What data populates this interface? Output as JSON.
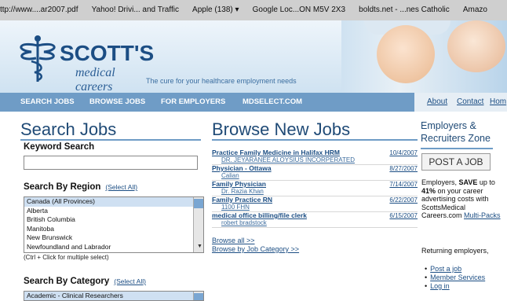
{
  "bookmarks": [
    "ttp://www....ar2007.pdf",
    "Yahoo! Drivi... and Traffic",
    "Apple (138) ▾",
    "Google Loc...ON M5V 2X3",
    "boldts.net - ...nes Catholic",
    "Amazo"
  ],
  "header": {
    "logo_name": "SCOTT'S",
    "logo_sub": "medical careers",
    "tagline": "The cure for your healthcare employment needs"
  },
  "nav": {
    "search_jobs": "SEARCH JOBS",
    "browse_jobs": "BROWSE JOBS",
    "for_employers": "FOR EMPLOYERS",
    "mdselect": "MDSELECT.COM"
  },
  "util": {
    "about": "About",
    "contact": "Contact",
    "home": "Hom"
  },
  "search": {
    "title": "Search Jobs",
    "keyword_label": "Keyword Search",
    "region_label": "Search By Region",
    "region_select_all": "(Select All)",
    "regions": [
      "Canada (All Provinces)",
      "Alberta",
      "British Columbia",
      "Manitoba",
      "New Brunswick",
      "Newfoundland and Labrador"
    ],
    "hint": "(Ctrl + Click for multiple select)",
    "category_label": "Search By Category",
    "category_select_all": "(Select All)",
    "categories": [
      "Academic - Clinical Researchers"
    ]
  },
  "browse": {
    "title": "Browse New Jobs",
    "jobs": [
      {
        "title": "Practice Family Medicine in Halifax HRM",
        "company": "DR. JEYARANEE ALOYSIUS INCORPERATED",
        "date": "10/4/2007"
      },
      {
        "title": "Physician - Ottawa",
        "company": "Calian",
        "date": "8/27/2007"
      },
      {
        "title": "Family Physician",
        "company": "Dr. Razia Khan",
        "date": "7/14/2007"
      },
      {
        "title": "Family Practice RN",
        "company": "1100 FHN",
        "date": "6/22/2007"
      },
      {
        "title": "medical office billing/file clerk",
        "company": "robert bradstock",
        "date": "6/15/2007"
      }
    ],
    "browse_all": "Browse all >>",
    "browse_by_category": "Browse by Job Category >>"
  },
  "employers": {
    "title": "Employers & Recruiters Zone",
    "post_button": "POST A JOB",
    "blurb_1": "Employers, ",
    "blurb_save": "SAVE",
    "blurb_2": " up to ",
    "blurb_pct": "41%",
    "blurb_3": " on your career advertising costs with ScottsMedical Careers.com",
    "multipacks": "Multi-Packs",
    "returning": "Returning employers,",
    "links": [
      "Post a job",
      "Member Services",
      "Log in"
    ]
  }
}
